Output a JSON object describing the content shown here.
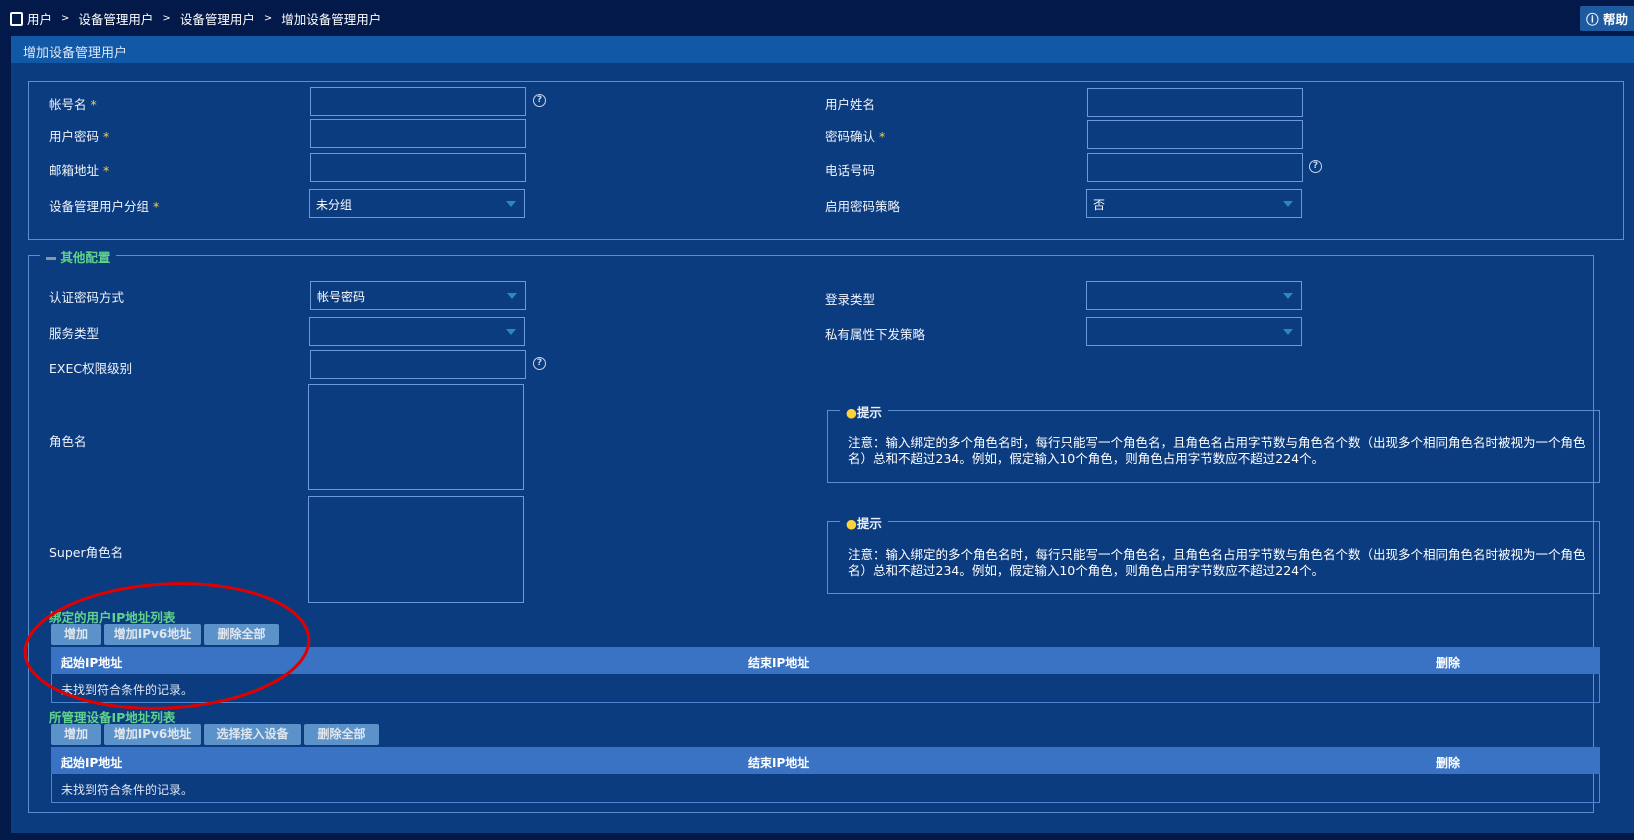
{
  "breadcrumb": [
    "用户",
    "设备管理用户",
    "设备管理用户",
    "增加设备管理用户"
  ],
  "help_label": "帮助",
  "panel_title": "增加设备管理用户",
  "basic": {
    "account": {
      "label": "帐号名",
      "required": "*",
      "value": ""
    },
    "fullname": {
      "label": "用户姓名",
      "value": ""
    },
    "password": {
      "label": "用户密码",
      "required": "*",
      "value": ""
    },
    "confirm": {
      "label": "密码确认",
      "required": "*",
      "value": ""
    },
    "email": {
      "label": "邮箱地址",
      "required": "*",
      "value": ""
    },
    "phone": {
      "label": "电话号码",
      "value": ""
    },
    "group": {
      "label": "设备管理用户分组",
      "required": "*",
      "value": "未分组"
    },
    "pwd_policy": {
      "label": "启用密码策略",
      "value": "否"
    }
  },
  "other": {
    "legend": "其他配置",
    "auth": {
      "label": "认证密码方式",
      "value": "帐号密码"
    },
    "login_type": {
      "label": "登录类型",
      "value": ""
    },
    "service": {
      "label": "服务类型",
      "value": ""
    },
    "private_attr": {
      "label": "私有属性下发策略",
      "value": ""
    },
    "exec": {
      "label": "EXEC权限级别",
      "value": ""
    },
    "role": {
      "label": "角色名",
      "value": ""
    },
    "super_role": {
      "label": "Super角色名",
      "value": ""
    },
    "hint_title": "提示",
    "hint_line1": "注意：输入绑定的多个角色名时，每行只能写一个角色名，且角色名占用字节数与角色名个数（出现多个相同角色名时被视为一个角色",
    "hint_line2": "名）总和不超过234。例如，假定输入10个角色，则角色占用字节数应不超过224个。"
  },
  "user_ip": {
    "title": "绑定的用户IP地址列表",
    "buttons": [
      "增加",
      "增加IPv6地址",
      "删除全部"
    ],
    "columns": [
      "起始IP地址",
      "结束IP地址",
      "删除"
    ],
    "empty": "未找到符合条件的记录。"
  },
  "device_ip": {
    "title": "所管理设备IP地址列表",
    "buttons": [
      "增加",
      "增加IPv6地址",
      "选择接入设备",
      "删除全部"
    ],
    "columns": [
      "起始IP地址",
      "结束IP地址",
      "删除"
    ],
    "empty": "未找到符合条件的记录。"
  },
  "colors": {
    "annotation": "#e00000",
    "accent_green": "#5fd38a"
  }
}
